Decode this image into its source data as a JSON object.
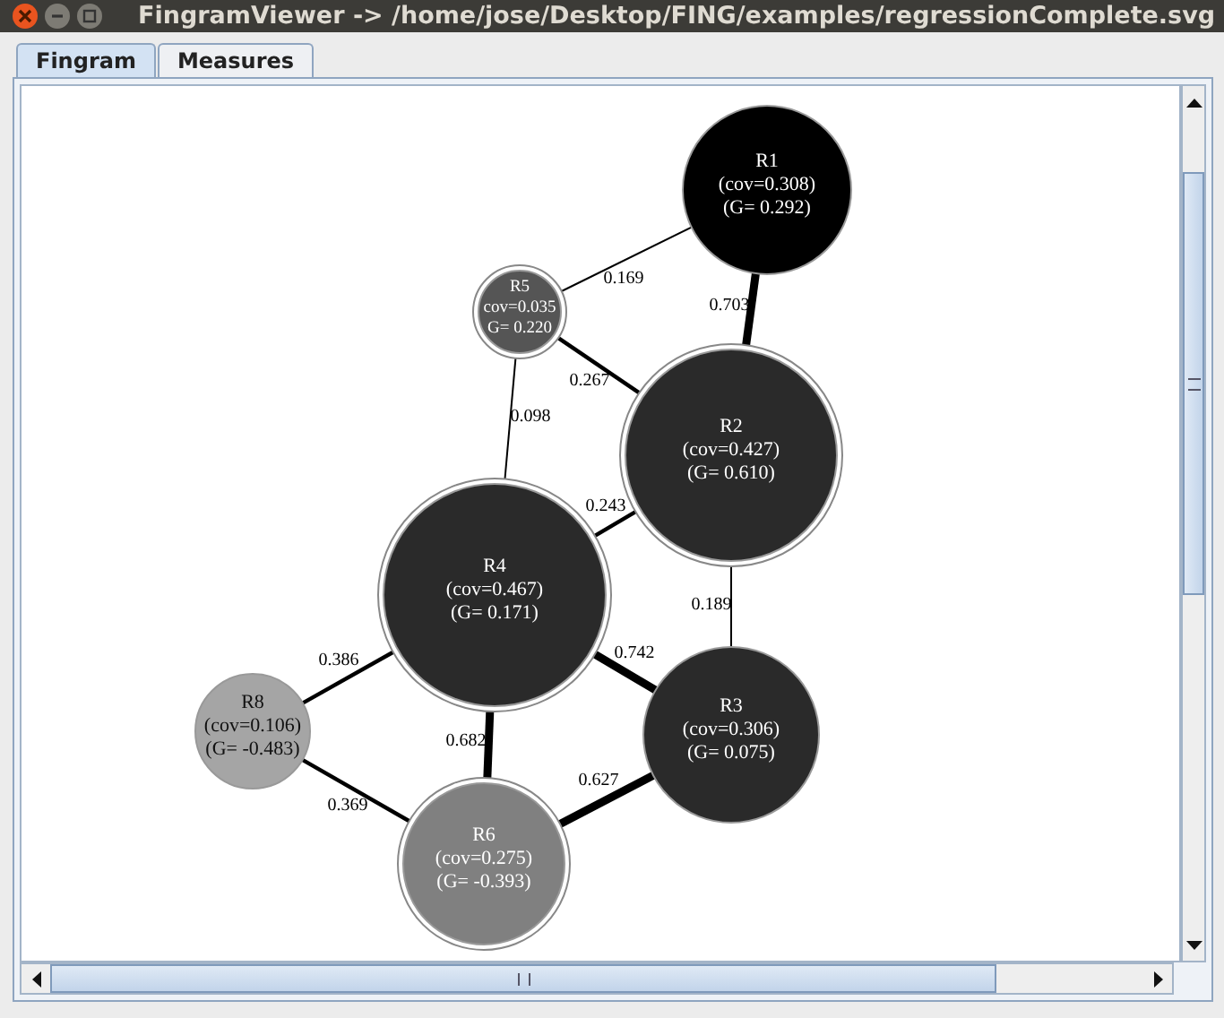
{
  "window": {
    "title": "FingramViewer -> /home/jose/Desktop/FING/examples/regressionComplete.svg"
  },
  "tabs": [
    {
      "label": "Fingram",
      "selected": true
    },
    {
      "label": "Measures",
      "selected": false
    }
  ],
  "fingram": {
    "nodes": [
      {
        "lines": [
          "R1",
          "(cov=0.308)",
          "(G= 0.292)"
        ],
        "color": "#000000",
        "kind": "plain"
      },
      {
        "lines": [
          "R5",
          "cov=0.035",
          "G= 0.220"
        ],
        "color": "#555555",
        "kind": "ring"
      },
      {
        "lines": [
          "R2",
          "(cov=0.427)",
          "(G= 0.610)"
        ],
        "color": "#2a2a2a",
        "kind": "ring"
      },
      {
        "lines": [
          "R4",
          "(cov=0.467)",
          "(G= 0.171)"
        ],
        "color": "#2a2a2a",
        "kind": "ring"
      },
      {
        "lines": [
          "R8",
          "(cov=0.106)",
          "(G= -0.483)"
        ],
        "color": "#a5a5a5",
        "kind": "plain"
      },
      {
        "lines": [
          "R3",
          "(cov=0.306)",
          "(G= 0.075)"
        ],
        "color": "#2a2a2a",
        "kind": "plain"
      },
      {
        "lines": [
          "R6",
          "(cov=0.275)",
          "(G= -0.393)"
        ],
        "color": "#808080",
        "kind": "ring"
      }
    ],
    "edges": [
      {
        "weight": "0.169",
        "kind": "thin"
      },
      {
        "weight": "0.703",
        "kind": "thick"
      },
      {
        "weight": "0.267",
        "kind": "medium"
      },
      {
        "weight": "0.098",
        "kind": "thin"
      },
      {
        "weight": "0.243",
        "kind": "medium"
      },
      {
        "weight": "0.189",
        "kind": "thin"
      },
      {
        "weight": "0.742",
        "kind": "thick"
      },
      {
        "weight": "0.386",
        "kind": "medium"
      },
      {
        "weight": "0.682",
        "kind": "thick"
      },
      {
        "weight": "0.369",
        "kind": "medium"
      },
      {
        "weight": "0.627",
        "kind": "thick"
      }
    ]
  }
}
